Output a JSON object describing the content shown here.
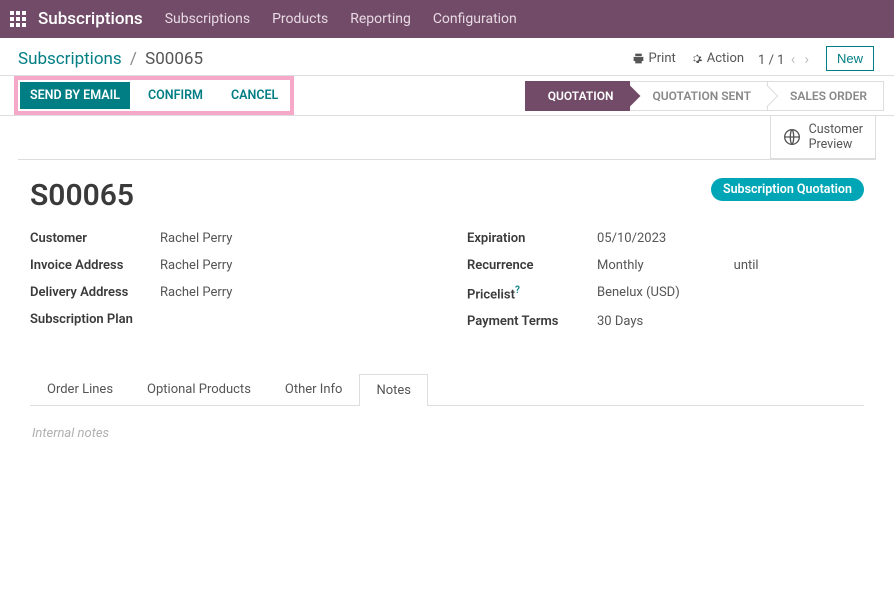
{
  "topbar": {
    "app": "Subscriptions",
    "menu": [
      "Subscriptions",
      "Products",
      "Reporting",
      "Configuration"
    ]
  },
  "breadcrumb": {
    "root": "Subscriptions",
    "sep": "/",
    "current": "S00065"
  },
  "toolbar": {
    "print": "Print",
    "action": "Action",
    "pager": "1 / 1",
    "new": "New"
  },
  "actions": {
    "send_email": "SEND BY EMAIL",
    "confirm": "CONFIRM",
    "cancel": "CANCEL"
  },
  "stages": [
    "QUOTATION",
    "QUOTATION SENT",
    "SALES ORDER"
  ],
  "active_stage": 0,
  "stat_button": {
    "line1": "Customer",
    "line2": "Preview"
  },
  "record": {
    "title": "S00065",
    "badge": "Subscription Quotation",
    "customer_lbl": "Customer",
    "customer": "Rachel Perry",
    "invoice_lbl": "Invoice Address",
    "invoice": "Rachel Perry",
    "delivery_lbl": "Delivery Address",
    "delivery": "Rachel Perry",
    "plan_lbl": "Subscription Plan",
    "plan": "",
    "expiration_lbl": "Expiration",
    "expiration": "05/10/2023",
    "recurrence_lbl": "Recurrence",
    "recurrence": "Monthly",
    "recurrence_until": "until",
    "pricelist_lbl": "Pricelist",
    "pricelist_help": "?",
    "pricelist": "Benelux (USD)",
    "terms_lbl": "Payment Terms",
    "terms": "30 Days"
  },
  "tabs": [
    "Order Lines",
    "Optional Products",
    "Other Info",
    "Notes"
  ],
  "active_tab": 3,
  "notes_placeholder": "Internal notes"
}
